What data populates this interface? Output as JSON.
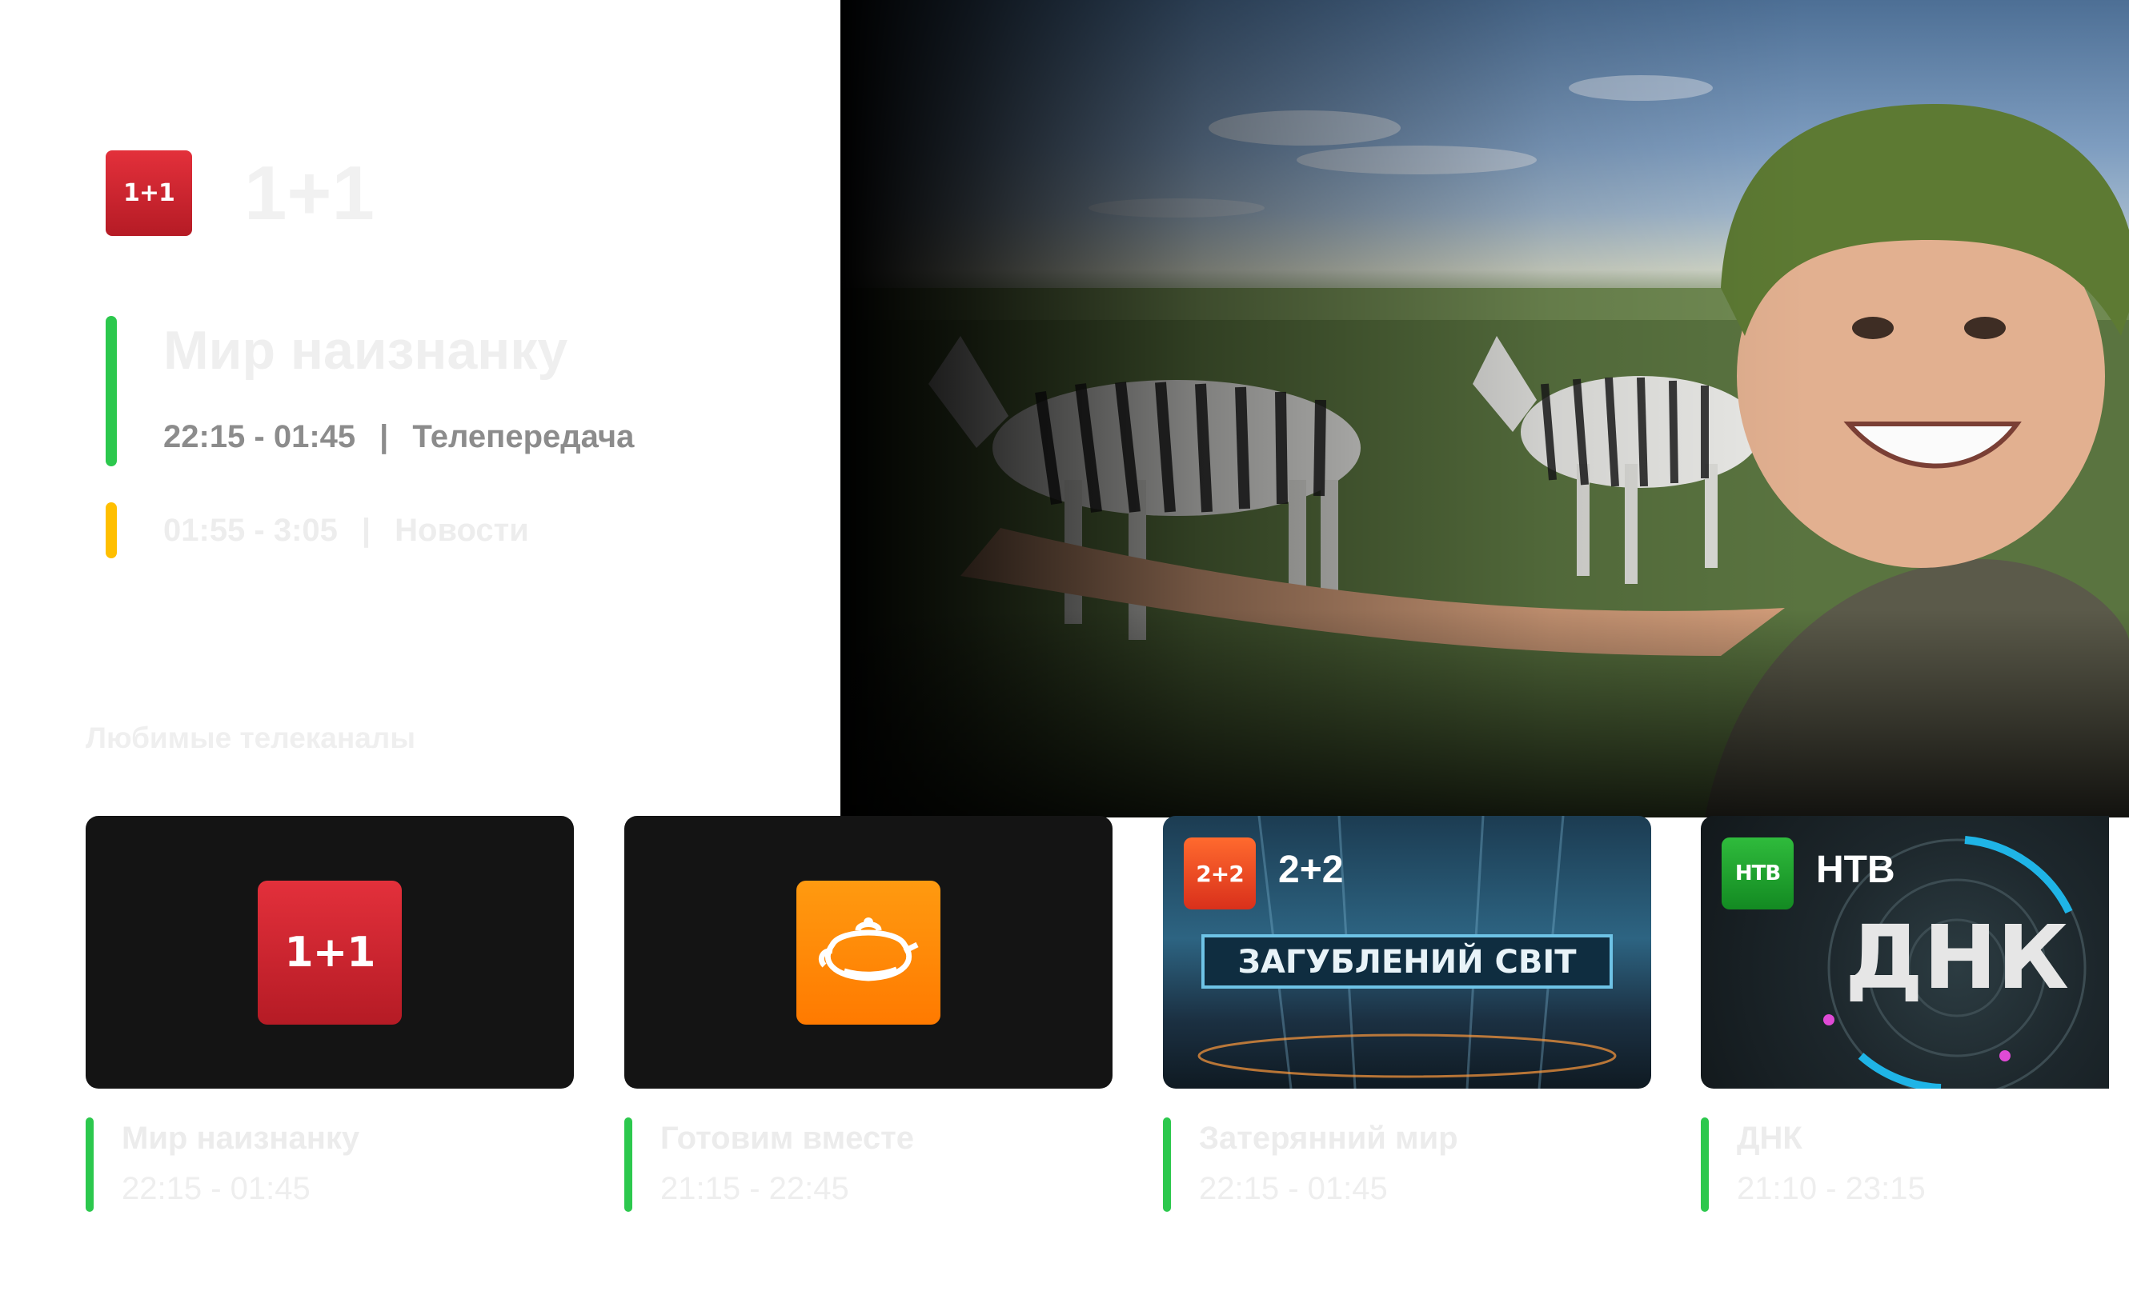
{
  "channel": {
    "logo_text": "1+1",
    "name": "1+1"
  },
  "now": {
    "title": "Мир наизнанку",
    "time": "22:15 - 01:45",
    "separator": "|",
    "genre": "Телепередача",
    "status_color": "#2cc84d"
  },
  "next": {
    "time": "01:55 - 3:05",
    "separator": "|",
    "genre": "Новости",
    "status_color": "#ffbf00"
  },
  "favorites": {
    "heading": "Любимые телеканалы",
    "cards": [
      {
        "logo_text": "1+1",
        "logo_color": "#c8202b",
        "title": "Мир наизнанку",
        "time": "22:15 - 01:45"
      },
      {
        "logo_icon": "teapot-icon",
        "logo_color": "#ff8400",
        "title": "Готовим вместе",
        "time": "21:15 - 22:45"
      },
      {
        "badge_text": "2+2",
        "channel_name": "2+2",
        "poster_text": "ЗАГУБЛЕНИЙ СВІТ",
        "title": "Затерянний мир",
        "time": "22:15 - 01:45"
      },
      {
        "badge_text": "НТВ",
        "channel_name": "НТВ",
        "poster_text": "ДНК",
        "title": "ДНК",
        "time": "21:10 - 23:15"
      }
    ]
  }
}
